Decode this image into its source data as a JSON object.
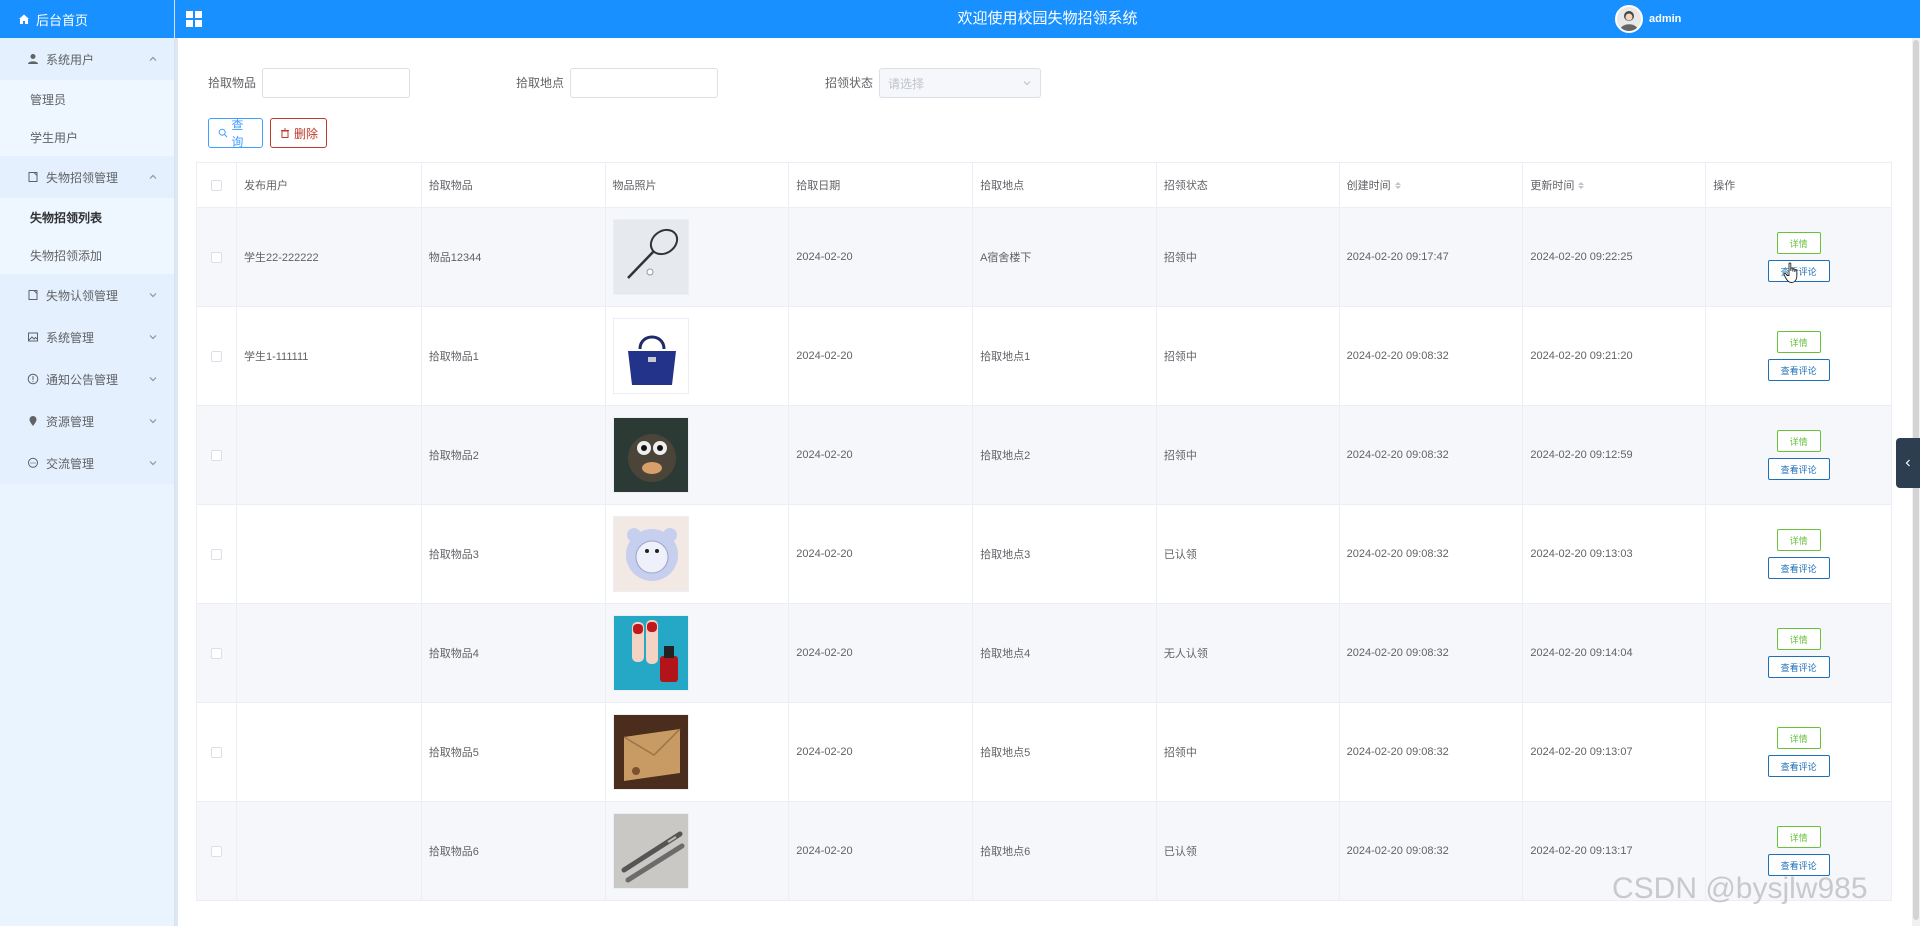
{
  "sidebar": {
    "home": "后台首页",
    "groups": [
      {
        "label": "系统用户",
        "icon": "user-icon",
        "items": [
          "管理员",
          "学生用户"
        ]
      },
      {
        "label": "失物招领管理",
        "icon": "document-icon",
        "items": [
          "失物招领列表",
          "失物招领添加"
        ]
      },
      {
        "label": "失物认领管理",
        "icon": "document-icon",
        "items": []
      },
      {
        "label": "系统管理",
        "icon": "image-icon",
        "items": []
      },
      {
        "label": "通知公告管理",
        "icon": "info-circle-icon",
        "items": []
      },
      {
        "label": "资源管理",
        "icon": "location-icon",
        "items": []
      },
      {
        "label": "交流管理",
        "icon": "chat-icon",
        "items": []
      }
    ]
  },
  "header": {
    "title": "欢迎使用校园失物招领系统",
    "username": "admin"
  },
  "search": {
    "item_label": "拾取物品",
    "item_value": "",
    "place_label": "拾取地点",
    "place_value": "",
    "status_label": "招领状态",
    "status_placeholder": "请选择"
  },
  "buttons": {
    "query": "查询",
    "delete": "删除"
  },
  "table": {
    "headers": [
      "发布用户",
      "拾取物品",
      "物品照片",
      "拾取日期",
      "拾取地点",
      "招领状态",
      "创建时间",
      "更新时间",
      "操作"
    ],
    "ops": {
      "detail": "详情",
      "comments": "查看评论"
    },
    "rows": [
      {
        "user": "学生22-222222",
        "item": "物品12344",
        "photo": "racket",
        "date": "2024-02-20",
        "place": "A宿舍楼下",
        "status": "招领中",
        "created": "2024-02-20 09:17:47",
        "updated": "2024-02-20 09:22:25"
      },
      {
        "user": "学生1-111111",
        "item": "拾取物品1",
        "photo": "handbag",
        "date": "2024-02-20",
        "place": "拾取地点1",
        "status": "招领中",
        "created": "2024-02-20 09:08:32",
        "updated": "2024-02-20 09:21:20"
      },
      {
        "user": "",
        "item": "拾取物品2",
        "photo": "toy",
        "date": "2024-02-20",
        "place": "拾取地点2",
        "status": "招领中",
        "created": "2024-02-20 09:08:32",
        "updated": "2024-02-20 09:12:59"
      },
      {
        "user": "",
        "item": "拾取物品3",
        "photo": "fan",
        "date": "2024-02-20",
        "place": "拾取地点3",
        "status": "已认领",
        "created": "2024-02-20 09:08:32",
        "updated": "2024-02-20 09:13:03"
      },
      {
        "user": "",
        "item": "拾取物品4",
        "photo": "nailpolish",
        "date": "2024-02-20",
        "place": "拾取地点4",
        "status": "无人认领",
        "created": "2024-02-20 09:08:32",
        "updated": "2024-02-20 09:14:04"
      },
      {
        "user": "",
        "item": "拾取物品5",
        "photo": "envelope",
        "date": "2024-02-20",
        "place": "拾取地点5",
        "status": "招领中",
        "created": "2024-02-20 09:08:32",
        "updated": "2024-02-20 09:13:07"
      },
      {
        "user": "",
        "item": "拾取物品6",
        "photo": "pens",
        "date": "2024-02-20",
        "place": "拾取地点6",
        "status": "已认领",
        "created": "2024-02-20 09:08:32",
        "updated": "2024-02-20 09:13:17"
      }
    ]
  },
  "watermark": "CSDN @bysjlw985",
  "colors": {
    "accent": "#1890ff",
    "sidebar_bg": "#eaf4fe",
    "detail": "#67c23a",
    "comment": "#1e6fb8",
    "delete": "#c0392b"
  }
}
